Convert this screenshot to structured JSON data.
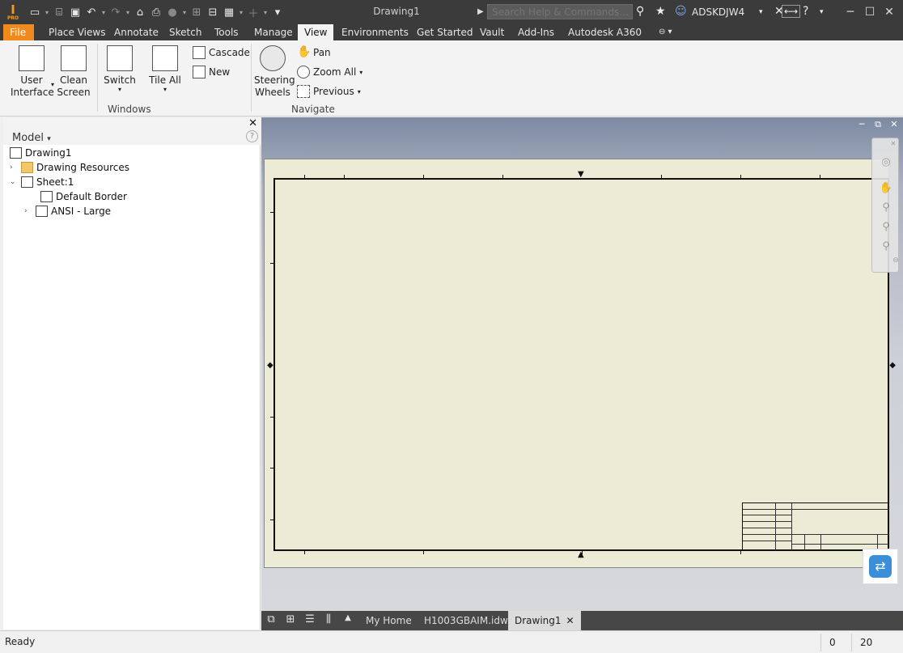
{
  "app": {
    "logo_letter": "I",
    "logo_sub": "PRO",
    "doc_title": "Drawing1",
    "search_placeholder": "Search Help & Commands...",
    "user_name": "ADSKDJW4"
  },
  "tabs": [
    {
      "label": "File"
    },
    {
      "label": "Place Views"
    },
    {
      "label": "Annotate"
    },
    {
      "label": "Sketch"
    },
    {
      "label": "Tools"
    },
    {
      "label": "Manage"
    },
    {
      "label": "View"
    },
    {
      "label": "Environments"
    },
    {
      "label": "Get Started"
    },
    {
      "label": "Vault"
    },
    {
      "label": "Add-Ins"
    },
    {
      "label": "Autodesk A360"
    }
  ],
  "ribbon": {
    "user_interface": "User Interface",
    "clean_screen": "Clean Screen",
    "switch": "Switch",
    "tile_all": "Tile All",
    "cascade": "Cascade",
    "new": "New",
    "windows_group": "Windows",
    "steering_wheels": "Steering Wheels",
    "pan": "Pan",
    "zoom_all": "Zoom All",
    "previous": "Previous",
    "navigate_group": "Navigate"
  },
  "browser": {
    "title": "Model",
    "tree": [
      {
        "label": "Drawing1"
      },
      {
        "label": "Drawing Resources"
      },
      {
        "label": "Sheet:1"
      },
      {
        "label": "Default Border"
      },
      {
        "label": "ANSI - Large"
      }
    ]
  },
  "doc_tabs": [
    {
      "label": "My Home"
    },
    {
      "label": "H1003GBAIM.idw"
    },
    {
      "label": "Drawing1"
    }
  ],
  "status": {
    "text": "Ready",
    "count_a": "0",
    "count_b": "20"
  },
  "colors": {
    "file_tab": "#f08a1c",
    "titlebar": "#3b3b3b",
    "sheet": "#ececd6",
    "share_accent": "#3b8ed8"
  }
}
